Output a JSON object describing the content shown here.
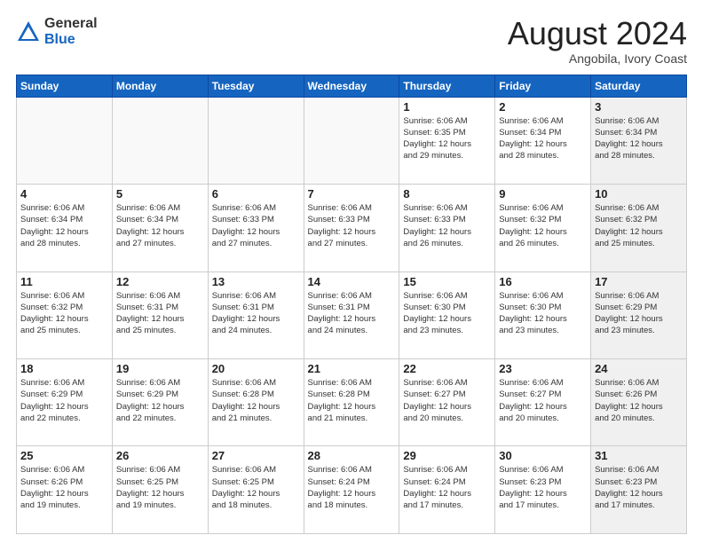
{
  "header": {
    "logo_general": "General",
    "logo_blue": "Blue",
    "month_title": "August 2024",
    "location": "Angobila, Ivory Coast"
  },
  "days_of_week": [
    "Sunday",
    "Monday",
    "Tuesday",
    "Wednesday",
    "Thursday",
    "Friday",
    "Saturday"
  ],
  "weeks": [
    [
      {
        "day": "",
        "empty": true
      },
      {
        "day": "",
        "empty": true
      },
      {
        "day": "",
        "empty": true
      },
      {
        "day": "",
        "empty": true
      },
      {
        "day": "1",
        "info": "Sunrise: 6:06 AM\nSunset: 6:35 PM\nDaylight: 12 hours\nand 29 minutes."
      },
      {
        "day": "2",
        "info": "Sunrise: 6:06 AM\nSunset: 6:34 PM\nDaylight: 12 hours\nand 28 minutes."
      },
      {
        "day": "3",
        "info": "Sunrise: 6:06 AM\nSunset: 6:34 PM\nDaylight: 12 hours\nand 28 minutes.",
        "shaded": true
      }
    ],
    [
      {
        "day": "4",
        "info": "Sunrise: 6:06 AM\nSunset: 6:34 PM\nDaylight: 12 hours\nand 28 minutes."
      },
      {
        "day": "5",
        "info": "Sunrise: 6:06 AM\nSunset: 6:34 PM\nDaylight: 12 hours\nand 27 minutes."
      },
      {
        "day": "6",
        "info": "Sunrise: 6:06 AM\nSunset: 6:33 PM\nDaylight: 12 hours\nand 27 minutes."
      },
      {
        "day": "7",
        "info": "Sunrise: 6:06 AM\nSunset: 6:33 PM\nDaylight: 12 hours\nand 27 minutes."
      },
      {
        "day": "8",
        "info": "Sunrise: 6:06 AM\nSunset: 6:33 PM\nDaylight: 12 hours\nand 26 minutes."
      },
      {
        "day": "9",
        "info": "Sunrise: 6:06 AM\nSunset: 6:32 PM\nDaylight: 12 hours\nand 26 minutes."
      },
      {
        "day": "10",
        "info": "Sunrise: 6:06 AM\nSunset: 6:32 PM\nDaylight: 12 hours\nand 25 minutes.",
        "shaded": true
      }
    ],
    [
      {
        "day": "11",
        "info": "Sunrise: 6:06 AM\nSunset: 6:32 PM\nDaylight: 12 hours\nand 25 minutes."
      },
      {
        "day": "12",
        "info": "Sunrise: 6:06 AM\nSunset: 6:31 PM\nDaylight: 12 hours\nand 25 minutes."
      },
      {
        "day": "13",
        "info": "Sunrise: 6:06 AM\nSunset: 6:31 PM\nDaylight: 12 hours\nand 24 minutes."
      },
      {
        "day": "14",
        "info": "Sunrise: 6:06 AM\nSunset: 6:31 PM\nDaylight: 12 hours\nand 24 minutes."
      },
      {
        "day": "15",
        "info": "Sunrise: 6:06 AM\nSunset: 6:30 PM\nDaylight: 12 hours\nand 23 minutes."
      },
      {
        "day": "16",
        "info": "Sunrise: 6:06 AM\nSunset: 6:30 PM\nDaylight: 12 hours\nand 23 minutes."
      },
      {
        "day": "17",
        "info": "Sunrise: 6:06 AM\nSunset: 6:29 PM\nDaylight: 12 hours\nand 23 minutes.",
        "shaded": true
      }
    ],
    [
      {
        "day": "18",
        "info": "Sunrise: 6:06 AM\nSunset: 6:29 PM\nDaylight: 12 hours\nand 22 minutes."
      },
      {
        "day": "19",
        "info": "Sunrise: 6:06 AM\nSunset: 6:29 PM\nDaylight: 12 hours\nand 22 minutes."
      },
      {
        "day": "20",
        "info": "Sunrise: 6:06 AM\nSunset: 6:28 PM\nDaylight: 12 hours\nand 21 minutes."
      },
      {
        "day": "21",
        "info": "Sunrise: 6:06 AM\nSunset: 6:28 PM\nDaylight: 12 hours\nand 21 minutes."
      },
      {
        "day": "22",
        "info": "Sunrise: 6:06 AM\nSunset: 6:27 PM\nDaylight: 12 hours\nand 20 minutes."
      },
      {
        "day": "23",
        "info": "Sunrise: 6:06 AM\nSunset: 6:27 PM\nDaylight: 12 hours\nand 20 minutes."
      },
      {
        "day": "24",
        "info": "Sunrise: 6:06 AM\nSunset: 6:26 PM\nDaylight: 12 hours\nand 20 minutes.",
        "shaded": true
      }
    ],
    [
      {
        "day": "25",
        "info": "Sunrise: 6:06 AM\nSunset: 6:26 PM\nDaylight: 12 hours\nand 19 minutes."
      },
      {
        "day": "26",
        "info": "Sunrise: 6:06 AM\nSunset: 6:25 PM\nDaylight: 12 hours\nand 19 minutes."
      },
      {
        "day": "27",
        "info": "Sunrise: 6:06 AM\nSunset: 6:25 PM\nDaylight: 12 hours\nand 18 minutes."
      },
      {
        "day": "28",
        "info": "Sunrise: 6:06 AM\nSunset: 6:24 PM\nDaylight: 12 hours\nand 18 minutes."
      },
      {
        "day": "29",
        "info": "Sunrise: 6:06 AM\nSunset: 6:24 PM\nDaylight: 12 hours\nand 17 minutes."
      },
      {
        "day": "30",
        "info": "Sunrise: 6:06 AM\nSunset: 6:23 PM\nDaylight: 12 hours\nand 17 minutes."
      },
      {
        "day": "31",
        "info": "Sunrise: 6:06 AM\nSunset: 6:23 PM\nDaylight: 12 hours\nand 17 minutes.",
        "shaded": true
      }
    ]
  ]
}
